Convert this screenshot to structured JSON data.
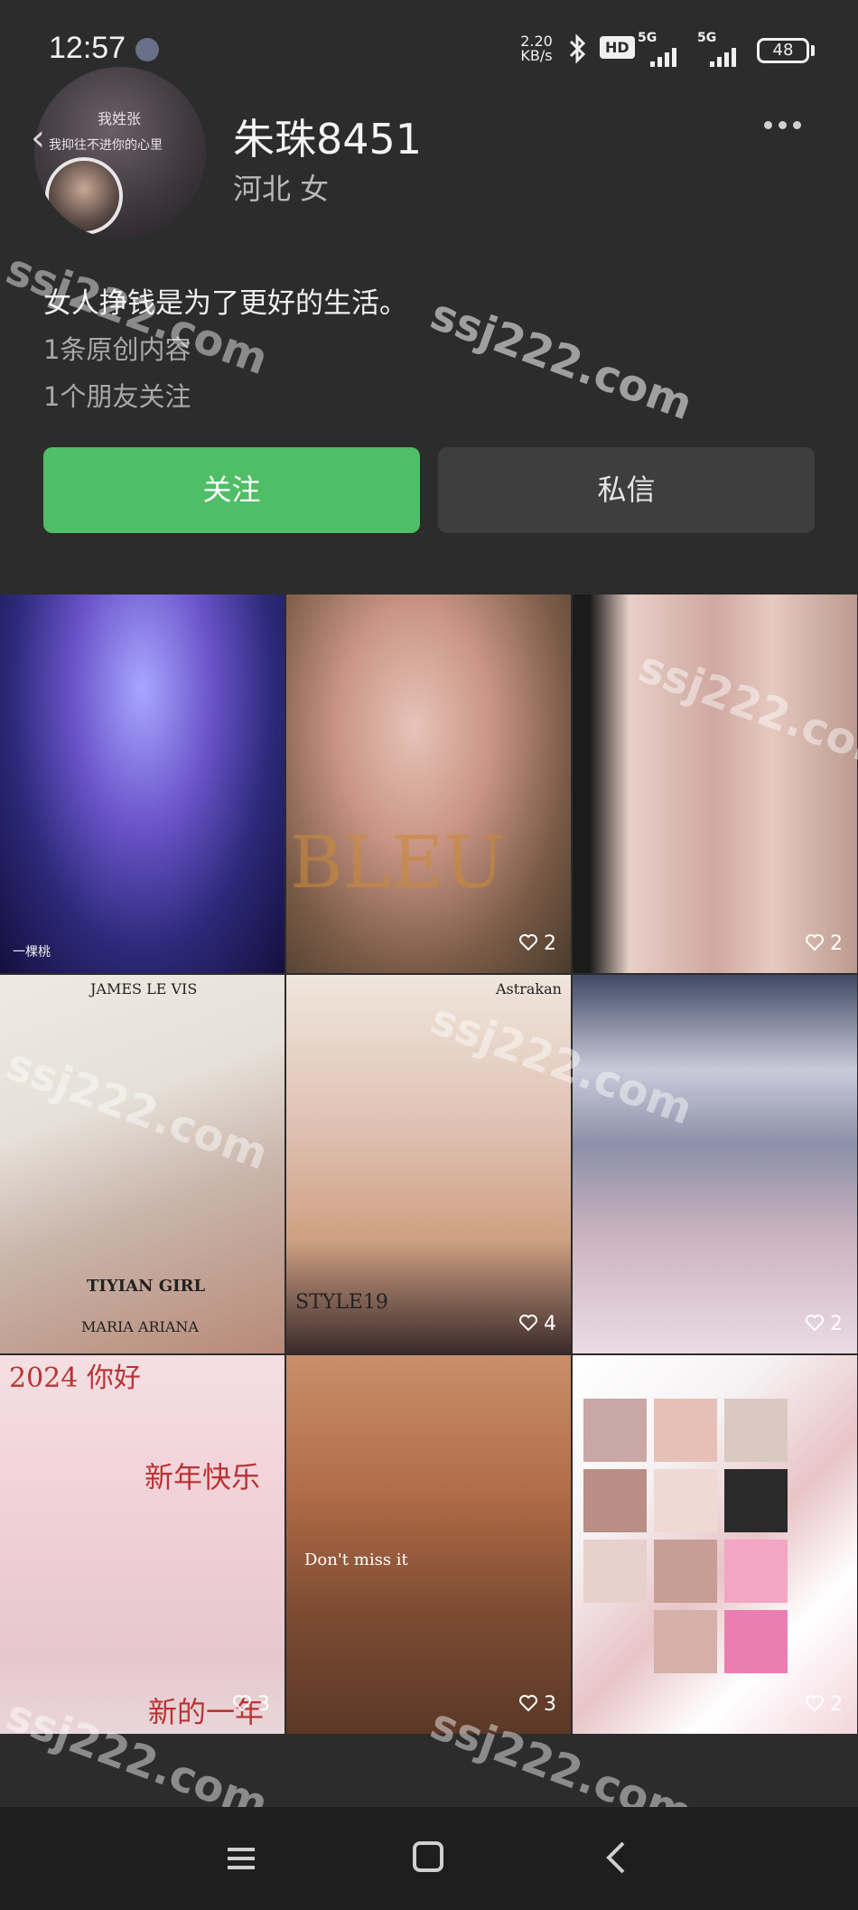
{
  "status_bar": {
    "time": "12:57",
    "net_speed_value": "2.20",
    "net_speed_unit": "KB/s",
    "hd_badge": "HD",
    "signal1_label": "5G",
    "signal2_label": "5G",
    "battery": "48"
  },
  "profile": {
    "avatar_line1": "我姓张",
    "avatar_line2": "我抑往不进你的心里",
    "name": "朱珠8451",
    "location_gender": "河北 女",
    "bio": "女人挣钱是为了更好的生活。",
    "original_count": "1条原创内容",
    "friends_follow": "1个朋友关注"
  },
  "buttons": {
    "follow": "关注",
    "message": "私信"
  },
  "grid": {
    "tiles": [
      {
        "likes": "",
        "overlay_text": "一棵桃"
      },
      {
        "likes": "2",
        "overlay_text": "BLEU"
      },
      {
        "likes": "2",
        "overlay_text": ""
      },
      {
        "likes": "",
        "overlay_text": "TIYIAN GIRL"
      },
      {
        "likes": "4",
        "overlay_text": "Astrakan"
      },
      {
        "likes": "2",
        "overlay_text": ""
      },
      {
        "likes": "3",
        "overlay_text": "新年快乐"
      },
      {
        "likes": "3",
        "overlay_text": "Don't miss it"
      },
      {
        "likes": "2",
        "overlay_text": ""
      }
    ],
    "tile4_sub1": "JAMES LE VIS",
    "tile4_sub2": "MARIA ARIANA",
    "tile5_word": "STYLE19",
    "tile7_top": "2024 你好",
    "tile7_bottom": "新的一年"
  },
  "watermark": "ssj222.com",
  "nav": {
    "menu_icon": "menu-icon",
    "home_icon": "home-icon",
    "back_icon": "back-icon"
  }
}
